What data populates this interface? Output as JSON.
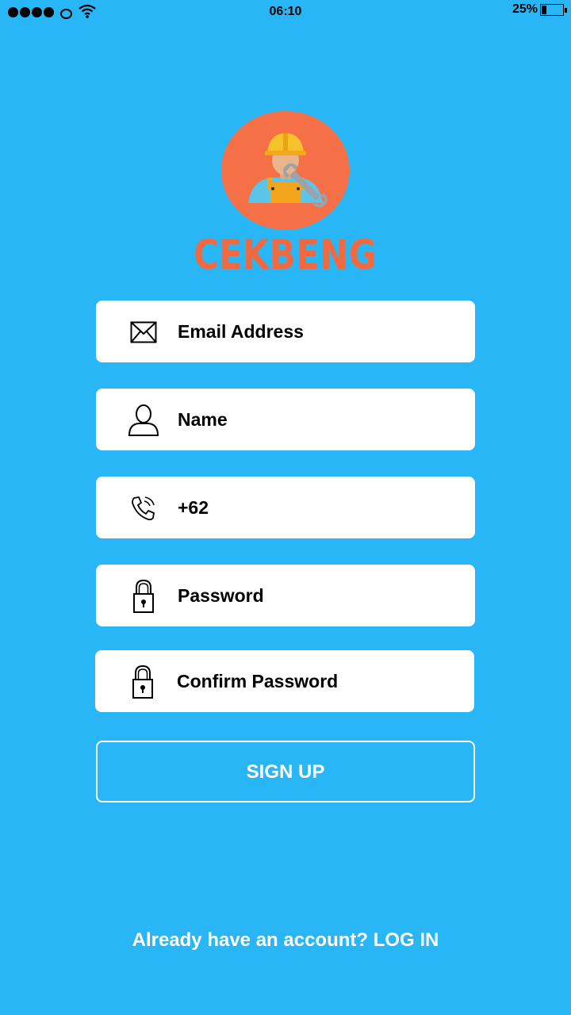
{
  "status_bar": {
    "time": "06:10",
    "battery_percent": "25%",
    "battery_level": 0.25,
    "signal_bars_filled": 4
  },
  "brand": {
    "name": "CEKBENG",
    "logo_icon": "mechanic-worker-icon",
    "accent_color": "#f2693f"
  },
  "form": {
    "email_placeholder": "Email Address",
    "name_placeholder": "Name",
    "phone_prefix": "+62",
    "password_placeholder": "Password",
    "confirm_password_placeholder": "Confirm Password",
    "signup_label": "SIGN UP"
  },
  "footer": {
    "prompt": "Already have an account?",
    "login_label": "LOG IN"
  },
  "colors": {
    "background": "#29b6f6",
    "field_background": "#ffffff"
  }
}
